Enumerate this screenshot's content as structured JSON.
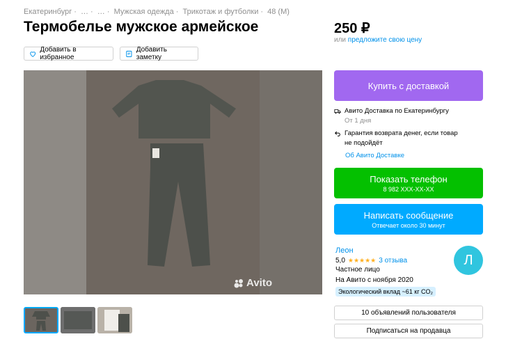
{
  "breadcrumb": [
    "Екатеринбург ·",
    "… ·",
    "… ·",
    "Мужская одежда ·",
    "Трикотаж и футболки ·",
    "48 (M)"
  ],
  "title": "Термобелье мужское армейское",
  "actions": {
    "favorite": "Добавить в избранное",
    "note": "Добавить заметку"
  },
  "gallery": {
    "watermark": "Avito",
    "thumbnail_count": 3,
    "active_thumbnail": 1
  },
  "price": {
    "value": "250 ₽",
    "or": "или",
    "suggest": "предложите свою цену"
  },
  "buy_button": "Купить с доставкой",
  "delivery": {
    "title": "Авито Доставка по Екатеринбургу",
    "eta": "От 1 дня"
  },
  "guarantee": {
    "line1": "Гарантия возврата денег, если товар",
    "line2": "не подойдёт"
  },
  "about_delivery": "Об Авито Доставке",
  "phone_button": {
    "label": "Показать телефон",
    "number": "8 982 XXX-XX-XX"
  },
  "message_button": {
    "label": "Написать сообщение",
    "sub": "Отвечает около 30 минут"
  },
  "seller": {
    "name": "Леон",
    "rating": "5,0",
    "stars": "★★★★★",
    "reviews": "3 отзыва",
    "type": "Частное лицо",
    "since": "На Авито с ноября 2020",
    "eco": "Экологический вклад ~61 кг CO₂",
    "avatar_letter": "Л"
  },
  "secondary": {
    "ads": "10 объявлений пользователя",
    "subscribe": "Подписаться на продавца"
  },
  "colors": {
    "buy": "#a168f0",
    "phone": "#04c000",
    "message": "#00aaff",
    "link": "#0091ea",
    "avatar": "#30c5df"
  }
}
